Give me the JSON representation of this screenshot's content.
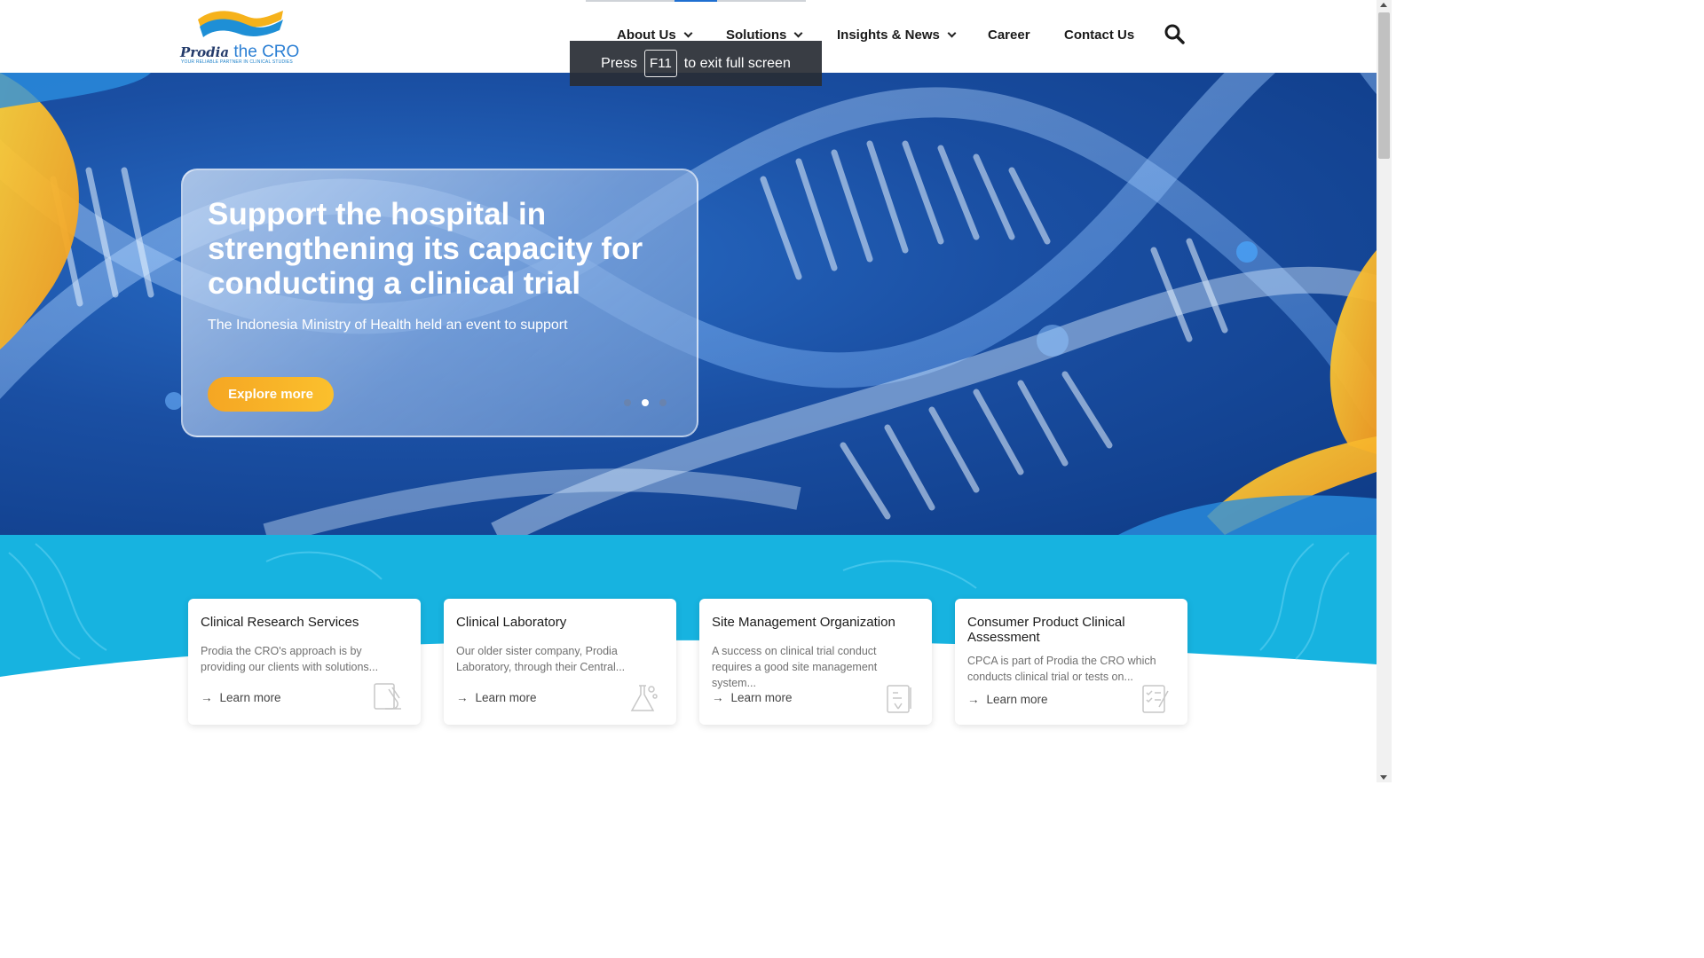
{
  "header": {
    "logo": {
      "brand": "Prodia",
      "name": "the CRO",
      "tagline": "YOUR RELIABLE PARTNER IN CLINICAL STUDIES"
    },
    "nav": [
      {
        "label": "About Us",
        "has_dropdown": true
      },
      {
        "label": "Solutions",
        "has_dropdown": true
      },
      {
        "label": "Insights & News",
        "has_dropdown": true
      },
      {
        "label": "Career",
        "has_dropdown": false
      },
      {
        "label": "Contact Us",
        "has_dropdown": false
      }
    ],
    "search_icon": "search-icon"
  },
  "fullscreen_toast": {
    "press": "Press",
    "key": "F11",
    "rest": "to exit full screen"
  },
  "hero": {
    "title": "Support the hospital in strengthening its capacity for conducting a clinical trial",
    "subtitle": "The Indonesia Ministry of Health held an event to support",
    "button": "Explore more",
    "slides": 3,
    "active_slide": 2
  },
  "services": [
    {
      "title": "Clinical Research Services",
      "text": "Prodia the CRO's approach is by providing our clients with solutions...",
      "link": "Learn more",
      "icon": "microscope-icon"
    },
    {
      "title": "Clinical Laboratory",
      "text": "Our older sister company, Prodia Laboratory, through their Central...",
      "link": "Learn more",
      "icon": "flask-icon"
    },
    {
      "title": "Site Management Organization",
      "text": "A success on clinical trial conduct requires a good site management system...",
      "link": "Learn more",
      "icon": "clipboard-icon"
    },
    {
      "title": "Consumer Product Clinical Assessment",
      "text": "CPCA is part of Prodia the CRO which conducts clinical trial or tests on...",
      "link": "Learn more",
      "icon": "checklist-icon"
    }
  ],
  "colors": {
    "accent": "#f5a623",
    "band_blue": "#17b3e0",
    "hero_blue": "#1a4fa3",
    "text_dark": "#1a1a1a"
  }
}
